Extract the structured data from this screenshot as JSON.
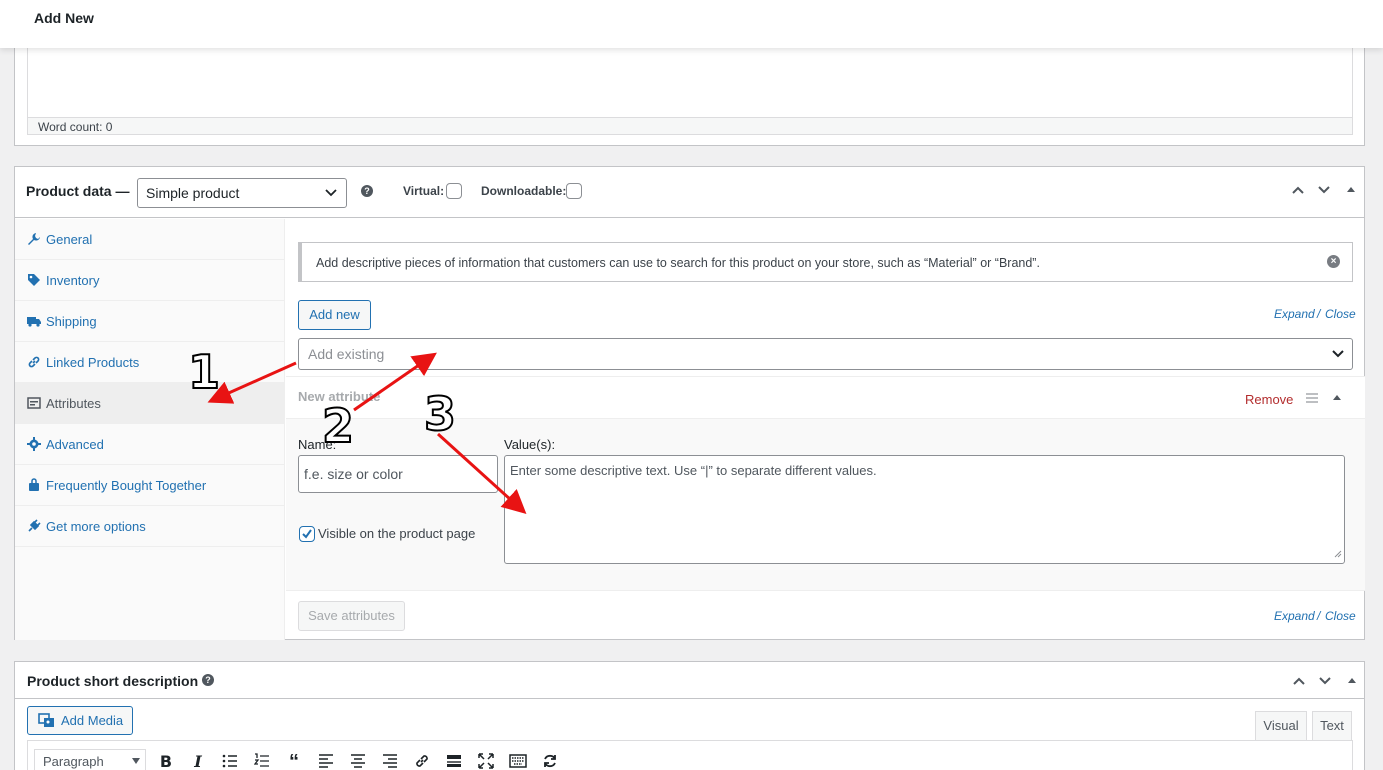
{
  "topbar": {
    "title": "Add New"
  },
  "editor": {
    "word_count": "Word count: 0"
  },
  "product_data": {
    "title": "Product data —",
    "type_select": "Simple product",
    "virtual_label": "Virtual:",
    "downloadable_label": "Downloadable:",
    "tabs": [
      {
        "label": "General",
        "icon": "wrench-icon"
      },
      {
        "label": "Inventory",
        "icon": "tag-icon"
      },
      {
        "label": "Shipping",
        "icon": "truck-icon"
      },
      {
        "label": "Linked Products",
        "icon": "link-icon"
      },
      {
        "label": "Attributes",
        "icon": "list-icon",
        "active": true
      },
      {
        "label": "Advanced",
        "icon": "gear-icon"
      },
      {
        "label": "Frequently Bought Together",
        "icon": "bag-icon"
      },
      {
        "label": "Get more options",
        "icon": "plug-icon"
      }
    ],
    "notice": "Add descriptive pieces of information that customers can use to search for this product on your store, such as “Material” or “Brand”.",
    "add_new": "Add new",
    "expand_close": "Expand",
    "close": "Close",
    "slash": "/",
    "add_existing_placeholder": "Add existing",
    "attribute": {
      "heading": "New attribute",
      "remove": "Remove",
      "name_label": "Name:",
      "name_placeholder": "f.e. size or color",
      "values_label": "Value(s):",
      "values_placeholder": "Enter some descriptive text. Use “|” to separate different values.",
      "visible_label": "Visible on the product page",
      "visible_checked": true
    },
    "save_attributes": "Save attributes"
  },
  "short_description": {
    "title": "Product short description",
    "add_media": "Add Media",
    "tab_visual": "Visual",
    "tab_text": "Text",
    "format_select": "Paragraph"
  },
  "annotations": {
    "one": "1",
    "two": "2",
    "three": "3",
    "arrow_color": "#e81313"
  }
}
